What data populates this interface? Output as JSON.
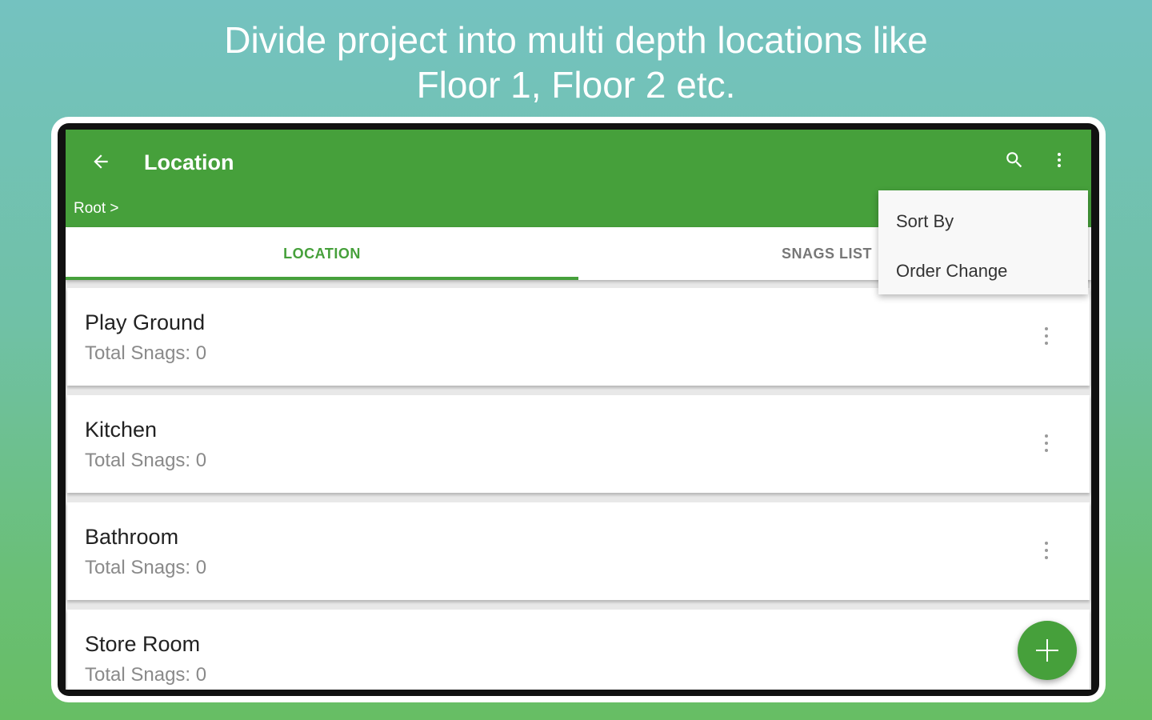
{
  "headline": {
    "line1": "Divide project into multi depth locations like",
    "line2": "Floor 1, Floor 2 etc."
  },
  "colors": {
    "primary": "#46a03b",
    "background_top": "#74c2c0",
    "background_bottom": "#67be64"
  },
  "appbar": {
    "back_icon": "arrow-left-icon",
    "title": "Location",
    "search_icon": "search-icon",
    "more_icon": "more-vertical-icon",
    "breadcrumb": "Root >"
  },
  "tabs": [
    {
      "label": "LOCATION",
      "active": true
    },
    {
      "label": "SNAGS LIST",
      "active": false
    }
  ],
  "menu": {
    "items": [
      {
        "label": "Sort By"
      },
      {
        "label": "Order Change"
      }
    ]
  },
  "locations": [
    {
      "name": "Play Ground",
      "snags": "Total Snags: 0"
    },
    {
      "name": "Kitchen",
      "snags": "Total Snags: 0"
    },
    {
      "name": "Bathroom",
      "snags": "Total Snags: 0"
    },
    {
      "name": "Store Room",
      "snags": "Total Snags: 0"
    }
  ],
  "fab": {
    "icon": "plus-icon"
  }
}
